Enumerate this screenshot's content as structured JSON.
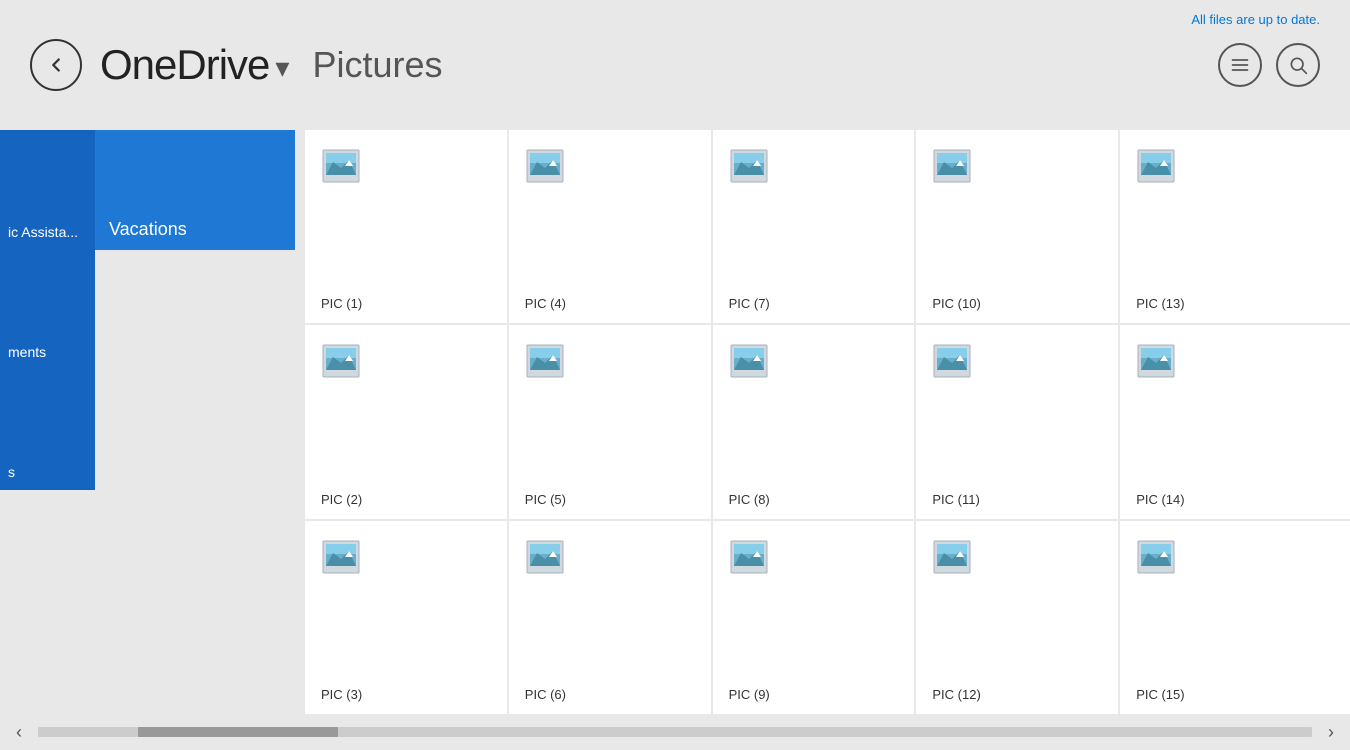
{
  "header": {
    "back_label": "back",
    "app_title": "OneDrive",
    "chevron": "▾",
    "page_title": "Pictures",
    "sync_status": "All files are up to date."
  },
  "icons": {
    "list_icon": "list",
    "search_icon": "search",
    "back_arrow": "←"
  },
  "sidebar": {
    "partial_items": [
      {
        "label": "ic Assista..."
      },
      {
        "label": "ments"
      },
      {
        "label": "s"
      }
    ],
    "main_items": [
      {
        "label": "Vacations",
        "selected": true
      }
    ]
  },
  "files": [
    {
      "name": "PIC (1)"
    },
    {
      "name": "PIC (4)"
    },
    {
      "name": "PIC (7)"
    },
    {
      "name": "PIC (10)"
    },
    {
      "name": "PIC (13)"
    },
    {
      "name": "PIC (2)"
    },
    {
      "name": "PIC (5)"
    },
    {
      "name": "PIC (8)"
    },
    {
      "name": "PIC (11)"
    },
    {
      "name": "PIC (14)"
    },
    {
      "name": "PIC (3)"
    },
    {
      "name": "PIC (6)"
    },
    {
      "name": "PIC (9)"
    },
    {
      "name": "PIC (12)"
    },
    {
      "name": "PIC (15)"
    }
  ],
  "scrollbar": {
    "left_arrow": "‹",
    "right_arrow": "›"
  }
}
